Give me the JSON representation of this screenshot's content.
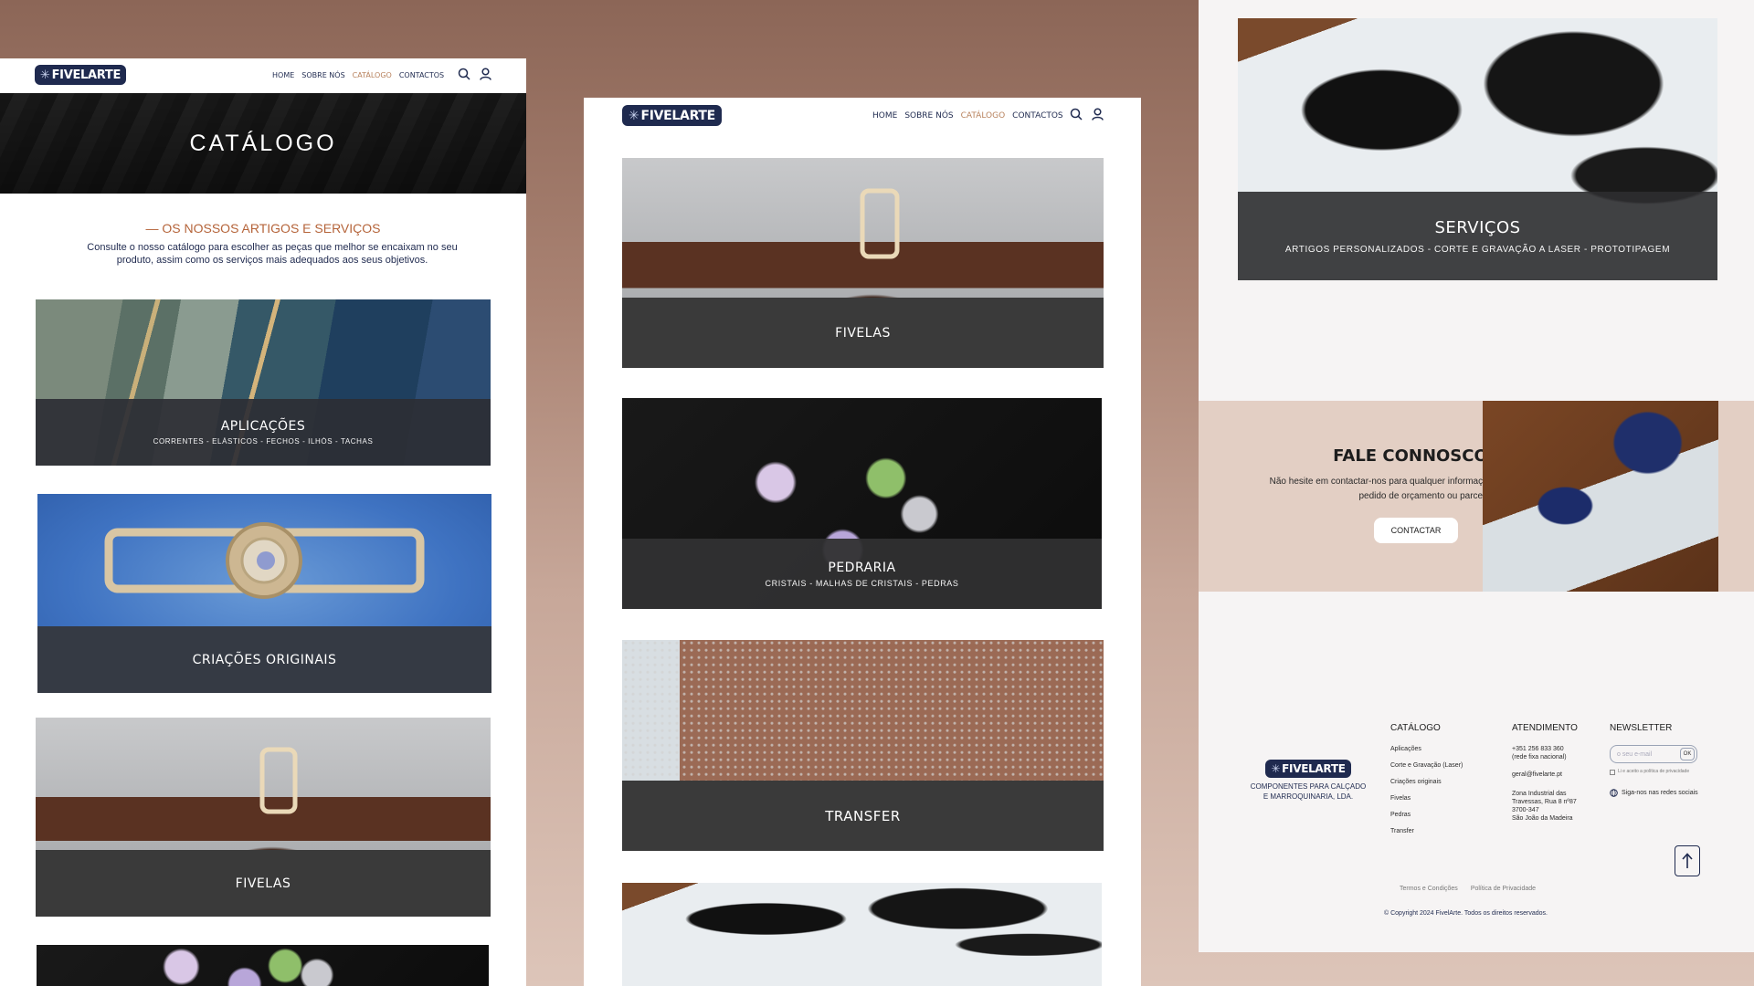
{
  "brand": {
    "name": "FIVELARTE"
  },
  "nav": {
    "links": [
      "HOME",
      "SOBRE NÓS",
      "CATÁLOGO",
      "CONTACTOS"
    ],
    "active": "CATÁLOGO"
  },
  "colors": {
    "navy": "#1f2a4f",
    "accent": "#b8825d",
    "caption": "#2c2e34",
    "contact_bg": "#e3cfc4"
  },
  "icons": [
    "search-icon",
    "user-icon",
    "arrow-up-icon",
    "globe-icon"
  ],
  "panel1": {
    "hero_title": "CATÁLOGO",
    "section_title": "— OS NOSSOS ARTIGOS E SERVIÇOS",
    "section_desc": "Consulte o nosso catálogo para  escolher as peças que melhor se encaixam no seu produto, assim como os serviços mais adequados aos seus objetivos.",
    "cards": [
      {
        "title": "APLICAÇÕES",
        "subtitle": "CORRENTES - ELÁSTICOS - FECHOS - ILHÓS - TACHAS"
      },
      {
        "title": "CRIAÇÕES ORIGINAIS",
        "subtitle": ""
      },
      {
        "title": "FIVELAS",
        "subtitle": ""
      }
    ]
  },
  "panel2": {
    "cards": [
      {
        "title": "FIVELAS",
        "subtitle": ""
      },
      {
        "title": "PEDRARIA",
        "subtitle": "CRISTAIS - MALHAS DE CRISTAIS - PEDRAS"
      },
      {
        "title": "TRANSFER",
        "subtitle": ""
      }
    ]
  },
  "panel3": {
    "services": {
      "title": "SERVIÇOS",
      "subtitle": "ARTIGOS PERSONALIZADOS - CORTE E GRAVAÇÃO A LASER - PROTOTIPAGEM"
    },
    "contact": {
      "title": "FALE CONNOSCO!",
      "text": "Não hesite em contactar-nos para qualquer informação, pedido de orçamento ou parceria!",
      "button": "CONTACTAR"
    },
    "footer": {
      "tagline": "COMPONENTES PARA CALÇADO E MARROQUINARIA, LDA.",
      "catalog": {
        "heading": "CATÁLOGO",
        "items": [
          "Aplicações",
          "Corte e Gravação (Laser)",
          "Criações originais",
          "Fivelas",
          "Pedras",
          "Transfer"
        ]
      },
      "support": {
        "heading": "ATENDIMENTO",
        "phone": "+351 256 833 360",
        "phone_note": "(rede fixa nacional)",
        "email": "geral@fivelarte.pt",
        "address": [
          "Zona Industrial das",
          "Travessas, Rua 8 nº87",
          "3700-347",
          "São João da Madeira"
        ]
      },
      "newsletter": {
        "heading": "NEWSLETTER",
        "placeholder": "o seu e-mail",
        "ok": "OK",
        "consent": "Li e aceito a política de privacidade",
        "social": "Siga-nos nas redes sociais"
      },
      "legal": [
        "Termos e Condições",
        "Política de Privacidade"
      ],
      "copyright": "© Copyright 2024 FivelArte. Todos os direitos reservados."
    }
  }
}
